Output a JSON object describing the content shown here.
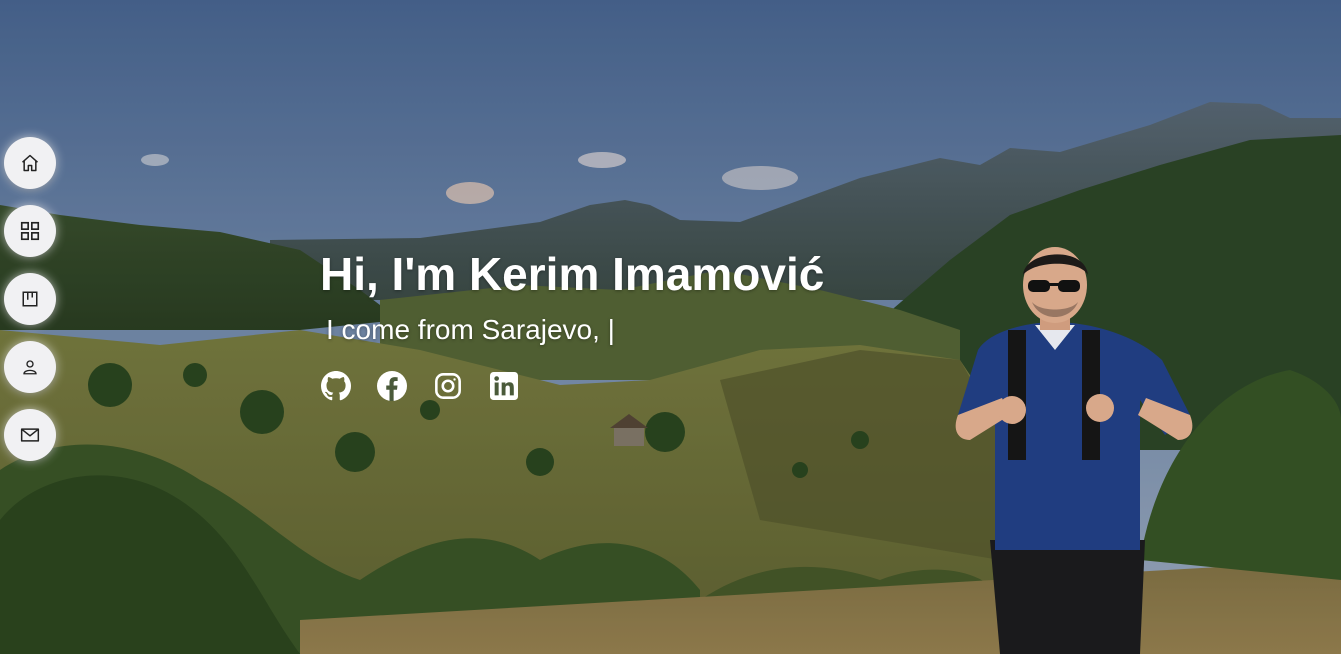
{
  "hero": {
    "title": "Hi, I'm Kerim Imamović",
    "subtitle": "I come from Sarajevo, |"
  },
  "sidebar": {
    "items": [
      {
        "icon": "home-icon"
      },
      {
        "icon": "grid-icon"
      },
      {
        "icon": "kanban-icon"
      },
      {
        "icon": "user-icon"
      },
      {
        "icon": "mail-icon"
      }
    ]
  },
  "socials": [
    {
      "icon": "github-icon"
    },
    {
      "icon": "facebook-icon"
    },
    {
      "icon": "instagram-icon"
    },
    {
      "icon": "linkedin-icon"
    }
  ],
  "colors": {
    "sky_top": "#4f6e9c",
    "sky_bottom": "#9fb1c9",
    "text": "#ffffff",
    "nav_bg": "#f1f1f3",
    "shirt": "#1f3a7a"
  }
}
